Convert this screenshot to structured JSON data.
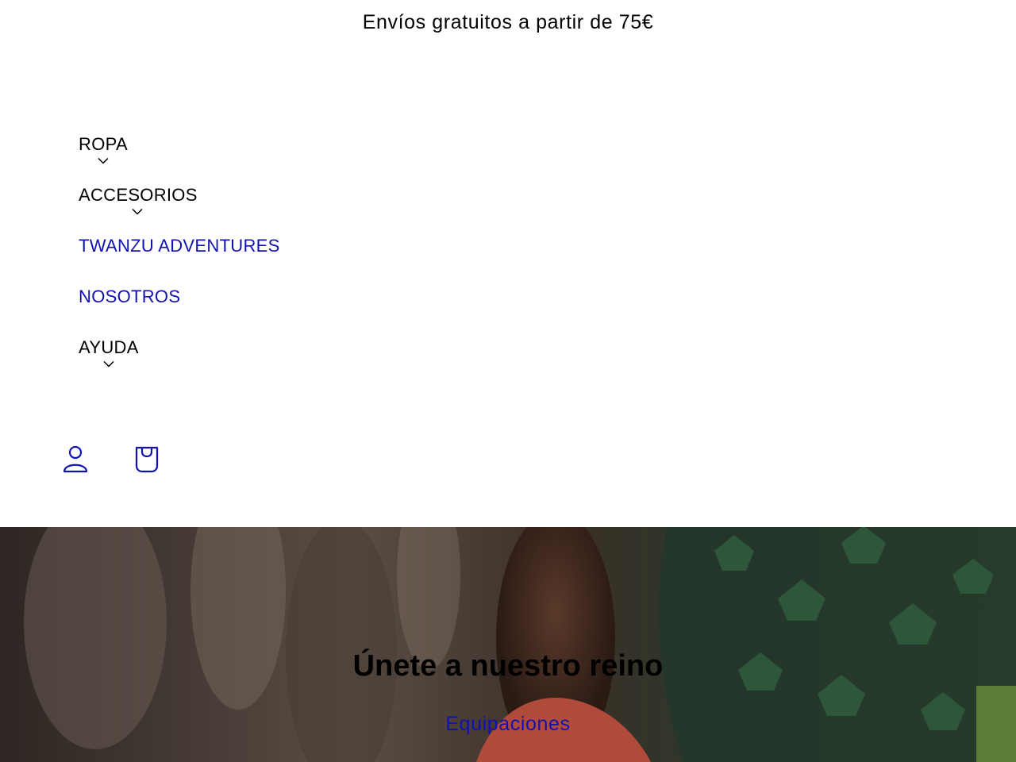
{
  "announcement": {
    "text": "Envíos gratuitos a partir de 75€"
  },
  "nav": {
    "items": [
      {
        "label": "ROPA",
        "has_dropdown": true
      },
      {
        "label": "ACCESORIOS",
        "has_dropdown": true
      },
      {
        "label": "TWANZU ADVENTURES",
        "has_dropdown": false
      },
      {
        "label": "NOSOTROS",
        "has_dropdown": false
      },
      {
        "label": "AYUDA",
        "has_dropdown": true
      }
    ]
  },
  "header_icons": {
    "account": "user-icon",
    "cart": "shopping-bag-icon"
  },
  "hero": {
    "title": "Únete a nuestro reino",
    "link_label": "Equipaciones"
  },
  "colors": {
    "link": "#1111b3",
    "text": "#000000",
    "background": "#ffffff"
  }
}
